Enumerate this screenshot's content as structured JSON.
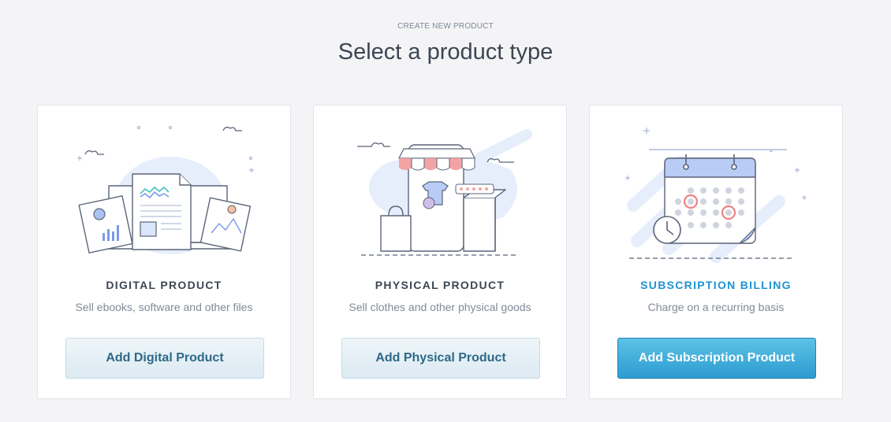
{
  "header": {
    "eyebrow": "CREATE NEW PRODUCT",
    "title": "Select a product type"
  },
  "cards": [
    {
      "name": "DIGITAL PRODUCT",
      "description": "Sell ebooks, software and other files",
      "button_label": "Add Digital Product",
      "illustration": "digital-files-illustration"
    },
    {
      "name": "PHYSICAL PRODUCT",
      "description": "Sell clothes and other physical goods",
      "button_label": "Add Physical Product",
      "illustration": "storefront-phone-illustration"
    },
    {
      "name": "SUBSCRIPTION BILLING",
      "description": "Charge on a recurring basis",
      "button_label": "Add Subscription Product",
      "illustration": "calendar-clock-illustration",
      "highlighted": true
    }
  ],
  "colors": {
    "accent": "#1c93d2",
    "title": "#3c4653",
    "muted": "#808a96",
    "button_text": "#2e6987"
  }
}
